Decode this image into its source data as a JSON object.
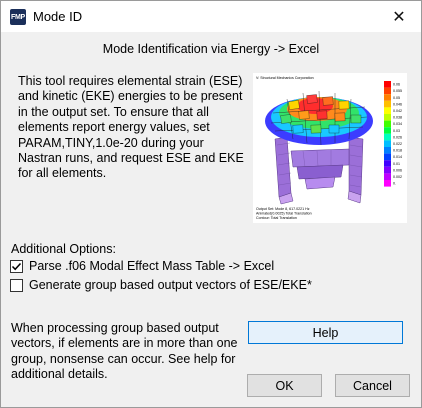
{
  "window": {
    "title": "Mode ID",
    "app_icon_text": "FMP",
    "close_glyph": "✕"
  },
  "main": {
    "heading": "Mode Identification via Energy -> Excel",
    "description": "This tool requires elemental strain (ESE)\nand kinetic (EKE) energies to be present\nin the output set. To ensure that all\nelements report energy values, set\nPARAM,TINY,1.0e-20 during your\nNastran runs, and request ESE and EKE\nfor all elements.",
    "figure": {
      "header_text": "V: Structural Mechanics Corporation",
      "footer_lines": [
        "Output Set: Mode 8, 617.0221 Hz",
        "Animated(0.0025) Total Translation",
        "Contour: Total Translation"
      ],
      "legend_values": [
        "0.06",
        "0.055",
        "0.05",
        "0.046",
        "0.042",
        "0.038",
        "0.034",
        "0.03",
        "0.026",
        "0.022",
        "0.018",
        "0.014",
        "0.01",
        "0.006",
        "0.002",
        "0."
      ],
      "legend_colors": [
        "#ff0000",
        "#ff4000",
        "#ff8000",
        "#ffbf00",
        "#ffff00",
        "#bfff00",
        "#40ff00",
        "#00ff40",
        "#00ffbf",
        "#00bfff",
        "#0080ff",
        "#0040ff",
        "#4000ff",
        "#8000ff",
        "#bf00ff",
        "#ff00ff"
      ]
    }
  },
  "options": {
    "label": "Additional Options:",
    "parse_f06": {
      "label": "Parse .f06 Modal Effect Mass Table -> Excel",
      "checked": true
    },
    "group_vectors": {
      "label": "Generate group based output vectors of ESE/EKE*",
      "checked": false
    }
  },
  "note": "When processing group based output\nvectors, if elements are in more than one\ngroup, nonsense can occur. See help for\nadditional details.",
  "buttons": {
    "help": "Help",
    "ok": "OK",
    "cancel": "Cancel"
  },
  "colors": {
    "accent": "#0078d7",
    "window_bg": "#f0f0f0"
  }
}
